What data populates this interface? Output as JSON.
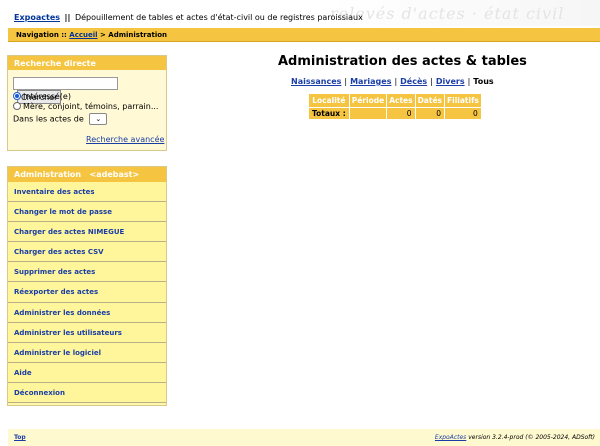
{
  "header": {
    "site_link": "Expoactes",
    "separator": "||",
    "subtitle": "Dépouillement de tables et actes d'état-civil ou de registres paroissiaux",
    "background_script": "relevés d'actes · état civil"
  },
  "navbar": {
    "prefix": "Navigation ::",
    "home_link": "Accueil",
    "current": "> Administration"
  },
  "search": {
    "title": "Recherche directe",
    "input_value": "",
    "button_label": "Chercher",
    "radio_options": [
      "Intéressé(e)",
      "Mère, conjoint, témoins, parrain..."
    ],
    "selected_option": 0,
    "acts_label": "Dans les actes de",
    "acts_select_value": "",
    "advanced_link": "Recherche avancée"
  },
  "admin_menu": {
    "title": "Administration",
    "user": "<adebast>",
    "items": [
      "Inventaire des actes",
      "Changer le mot de passe",
      "Charger des actes NIMEGUE",
      "Charger des actes CSV",
      "Supprimer des actes",
      "Réexporter des actes",
      "Administrer les données",
      "Administrer les utilisateurs",
      "Administrer le logiciel",
      "Aide",
      "Déconnexion"
    ]
  },
  "main": {
    "title": "Administration des actes & tables",
    "filters": [
      "Naissances",
      "Mariages",
      "Décès",
      "Divers"
    ],
    "current_filter": "Tous",
    "table": {
      "headers": [
        "Localité",
        "Période",
        "Actes",
        "Datés",
        "Filiatifs"
      ],
      "totals_label": "Totaux :",
      "totals": [
        "",
        "",
        "0",
        "0",
        "0"
      ]
    }
  },
  "footer": {
    "top_link": "Top",
    "product_link": "ExpoActes",
    "version_text": "version 3.2.4-prod (© 2005-2024, ADSoft)"
  },
  "colors": {
    "accent": "#f5c542",
    "link": "#1a3ea6",
    "menu_bg": "#fff59a",
    "panel_bg": "#fff9d6"
  }
}
